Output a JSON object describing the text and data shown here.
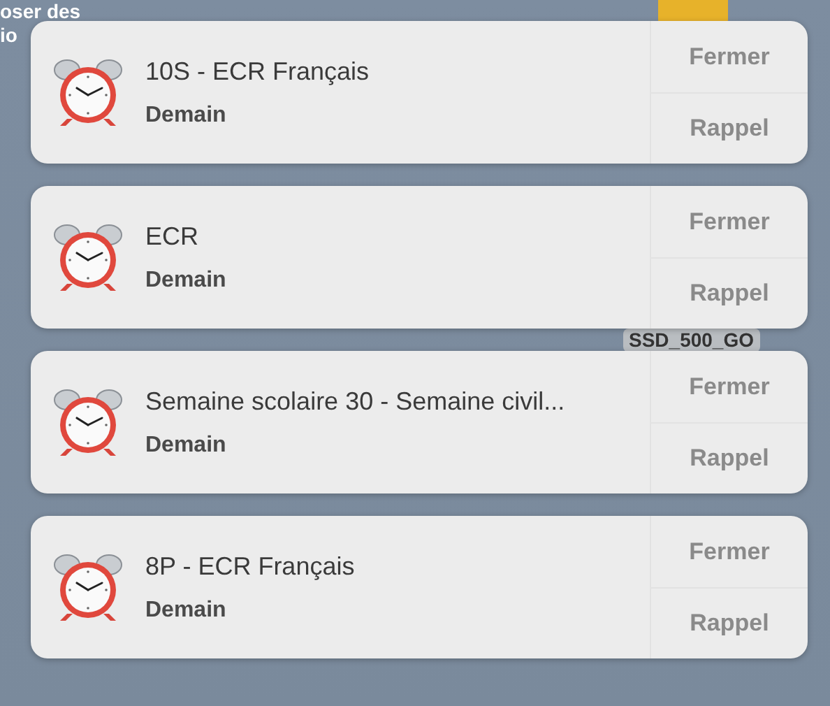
{
  "desktop": {
    "labels": [
      "oser des",
      "io"
    ],
    "drive_label": "SSD_500_GO"
  },
  "notifications": [
    {
      "title": "10S - ECR Français",
      "subtitle": "Demain",
      "actions": [
        "Fermer",
        "Rappel"
      ]
    },
    {
      "title": "ECR",
      "subtitle": "Demain",
      "actions": [
        "Fermer",
        "Rappel"
      ]
    },
    {
      "title": "Semaine scolaire 30 - Semaine civil...",
      "subtitle": "Demain",
      "actions": [
        "Fermer",
        "Rappel"
      ]
    },
    {
      "title": "8P - ECR Français",
      "subtitle": "Demain",
      "actions": [
        "Fermer",
        "Rappel"
      ]
    }
  ]
}
